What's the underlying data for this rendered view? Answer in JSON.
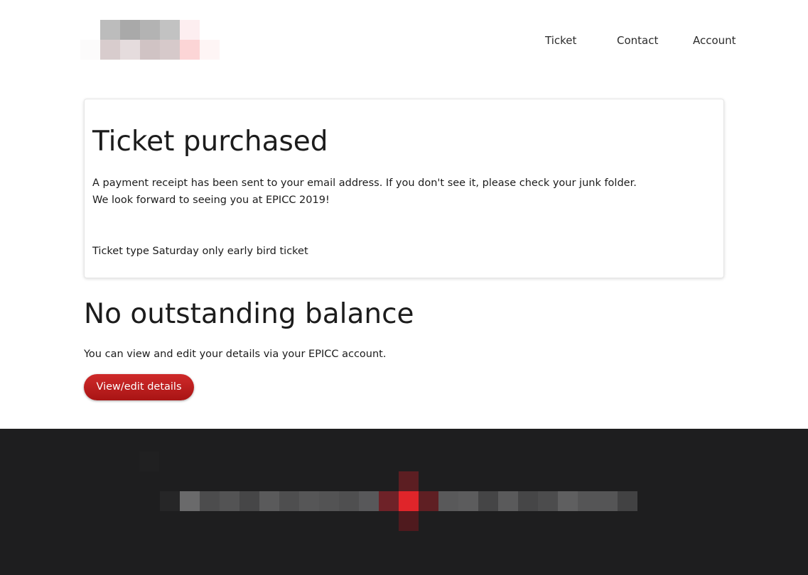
{
  "header": {
    "logo_name": "site-logo",
    "nav": [
      {
        "label": "Ticket"
      },
      {
        "label": "Contact"
      },
      {
        "label": "Account"
      }
    ]
  },
  "confirmation": {
    "title": "Ticket purchased",
    "receipt_line": "A payment receipt has been sent to your email address. If you don't see it, please check your junk folder.",
    "welcome_line": "We look forward to seeing you at EPICC 2019!",
    "ticket_type_line": "Ticket type Saturday only early bird ticket"
  },
  "balance": {
    "title": "No outstanding balance",
    "text": "You can view and edit your details via your EPICC account.",
    "button_label": "View/edit details"
  },
  "colors": {
    "accent": "#b81c1c",
    "footer_bg": "#1e1e1f"
  }
}
